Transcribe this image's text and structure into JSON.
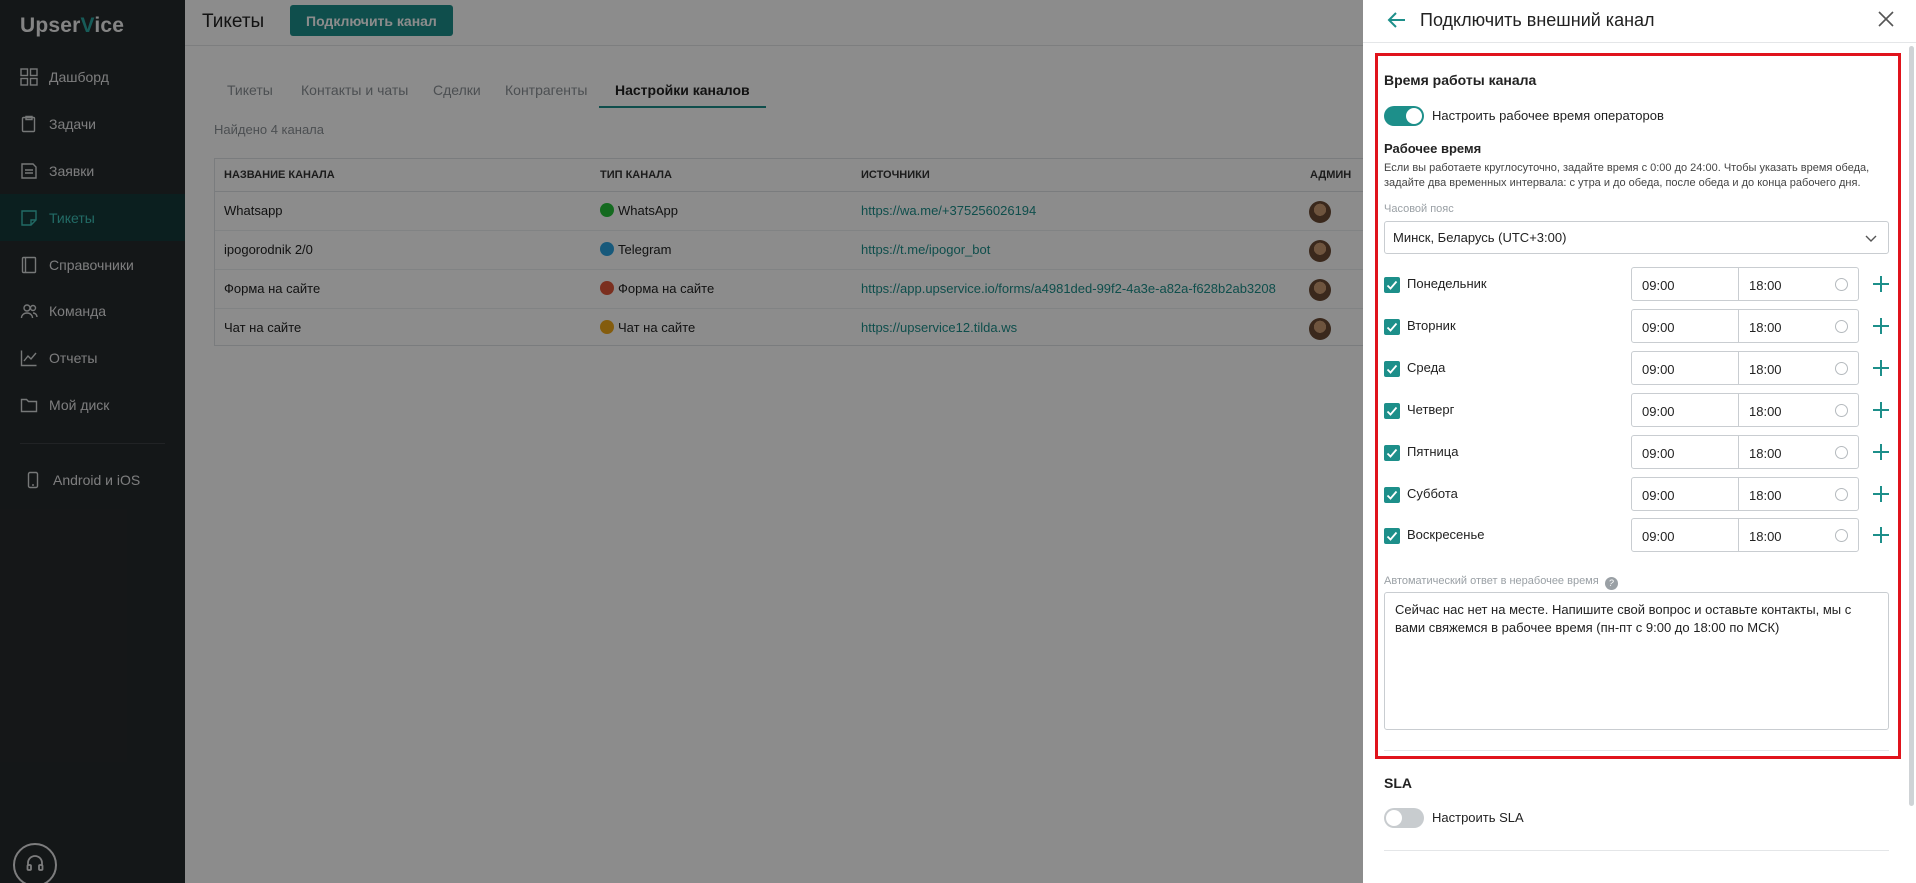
{
  "brand": {
    "logo_part1": "Upser",
    "logo_part2": "V",
    "logo_part3": "ice",
    "accent": "#1d8f8a"
  },
  "sidebar": {
    "items": [
      {
        "label": "Дашборд",
        "icon": "dashboard-icon"
      },
      {
        "label": "Задачи",
        "icon": "tasks-icon"
      },
      {
        "label": "Заявки",
        "icon": "requests-icon"
      },
      {
        "label": "Тикеты",
        "icon": "tickets-icon",
        "active": true
      },
      {
        "label": "Справочники",
        "icon": "directory-icon"
      },
      {
        "label": "Команда",
        "icon": "team-icon"
      },
      {
        "label": "Отчеты",
        "icon": "reports-icon"
      },
      {
        "label": "Мой диск",
        "icon": "folder-icon"
      }
    ],
    "mobile": {
      "label": "Android и iOS",
      "icon": "phone-icon"
    },
    "support_icon": "headset-icon"
  },
  "header": {
    "title": "Тикеты",
    "connect_label": "Подключить канал"
  },
  "tabs": [
    "Тикеты",
    "Контакты и чаты",
    "Сделки",
    "Контрагенты",
    "Настройки каналов"
  ],
  "found_text": "Найдено 4 канала",
  "table": {
    "headers": [
      "НАЗВАНИЕ КАНАЛА",
      "ТИП КАНАЛА",
      "ИСТОЧНИКИ",
      "АДМИН"
    ],
    "rows": [
      {
        "name": "Whatsapp",
        "type": "WhatsApp",
        "type_color": "#25c23a",
        "source": "https://wa.me/+375256026194"
      },
      {
        "name": "ipogorodnik 2/0",
        "type": "Telegram",
        "type_color": "#2aa3e0",
        "source": "https://t.me/ipogor_bot"
      },
      {
        "name": "Форма на сайте",
        "type": "Форма на сайте",
        "type_color": "#e0563a",
        "source": "https://app.upservice.io/forms/a4981ded-99f2-4a3e-a82a-f628b2ab3208"
      },
      {
        "name": "Чат на сайте",
        "type": "Чат на сайте",
        "type_color": "#f0a818",
        "source": "https://upservice12.tilda.ws"
      }
    ]
  },
  "panel": {
    "title": "Подключить внешний канал",
    "work_hours_title": "Время работы канала",
    "work_hours_toggle_label": "Настроить рабочее время операторов",
    "work_hours_toggle_on": true,
    "schedule_title": "Рабочее время",
    "schedule_hint_1": "Если вы работаете круглосуточно, задайте время с 0:00 до 24:00. Чтобы указать время обеда,",
    "schedule_hint_2": "задайте два временных интервала: с утра и до обеда, после обеда и до конца рабочего дня.",
    "timezone_label": "Часовой пояс",
    "timezone_value": "Минск, Беларусь (UTC+3:00)",
    "days": [
      {
        "name": "Понедельник",
        "from": "09:00",
        "to": "18:00",
        "checked": true
      },
      {
        "name": "Вторник",
        "from": "09:00",
        "to": "18:00",
        "checked": true
      },
      {
        "name": "Среда",
        "from": "09:00",
        "to": "18:00",
        "checked": true
      },
      {
        "name": "Четверг",
        "from": "09:00",
        "to": "18:00",
        "checked": true
      },
      {
        "name": "Пятница",
        "from": "09:00",
        "to": "18:00",
        "checked": true
      },
      {
        "name": "Суббота",
        "from": "09:00",
        "to": "18:00",
        "checked": true
      },
      {
        "name": "Воскресенье",
        "from": "09:00",
        "to": "18:00",
        "checked": true
      }
    ],
    "autoreply_label": "Автоматический ответ в нерабочее время",
    "autoreply_text": "Сейчас нас нет на месте. Напишите свой вопрос и оставьте контакты, мы с вами свяжемся в рабочее время (пн-пт с 9:00 до 18:00 по МСК)",
    "sla_title": "SLA",
    "sla_toggle_label": "Настроить SLA",
    "sla_toggle_on": false
  }
}
